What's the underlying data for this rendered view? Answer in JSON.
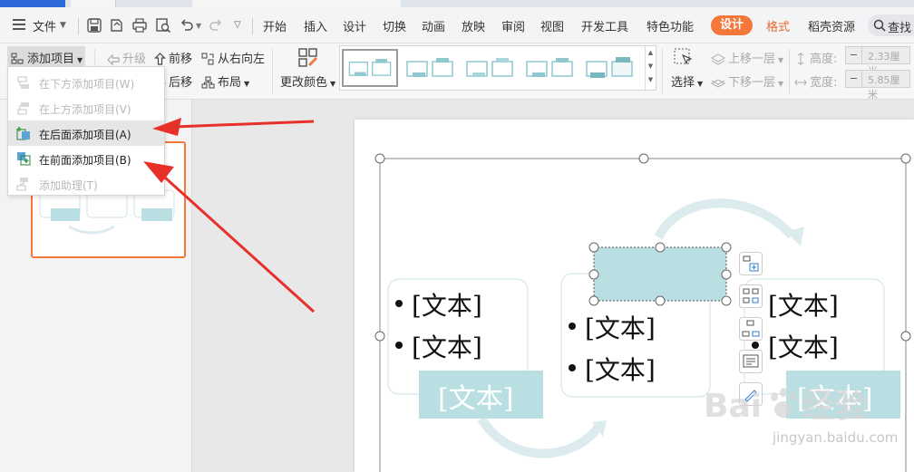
{
  "menubar": {
    "file": "文件",
    "tabs": [
      "开始",
      "插入",
      "设计",
      "切换",
      "动画",
      "放映",
      "审阅",
      "视图",
      "开发工具",
      "特色功能"
    ],
    "active_pill": "设计",
    "format_tab": "格式",
    "resources_tab": "稻壳资源",
    "search_label": "查找"
  },
  "ribbon": {
    "add_item": "添加项目",
    "upgrade": "升级",
    "move_forward": "前移",
    "right_to_left": "从右向左",
    "move_backward": "后移",
    "layout": "布局",
    "change_color": "更改颜色",
    "select": "选择",
    "bring_forward": "上移一层",
    "send_backward": "下移一层",
    "height_label": "高度:",
    "height_value": "2.33厘米",
    "width_label": "宽度:",
    "width_value": "5.85厘米"
  },
  "dropdown": {
    "items": [
      {
        "label": "在下方添加项目(W)",
        "enabled": false
      },
      {
        "label": "在上方添加项目(V)",
        "enabled": false
      },
      {
        "label": "在后面添加项目(A)",
        "enabled": true,
        "highlighted": true
      },
      {
        "label": "在前面添加项目(B)",
        "enabled": true
      },
      {
        "label": "添加助理(T)",
        "enabled": false
      }
    ]
  },
  "slide": {
    "bullet_text": "[文本]",
    "label_text": "[文本]"
  },
  "watermark": {
    "brand": "Baidu经验",
    "url": "jingyan.baidu.com"
  },
  "colors": {
    "accent_orange": "#f3783a",
    "arrow_red": "#e8302a",
    "smartart_teal": "#b9dfe3",
    "smartart_pale": "#dcebed"
  }
}
